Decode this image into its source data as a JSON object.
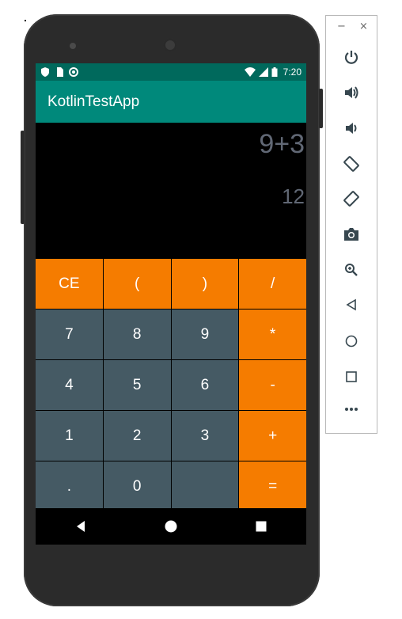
{
  "statusbar": {
    "time": "7:20",
    "icons_left": [
      "shield-icon",
      "sim-icon",
      "circle-icon"
    ],
    "icons_right": [
      "wifi-icon",
      "signal-icon",
      "battery-icon"
    ]
  },
  "app": {
    "title": "KotlinTestApp"
  },
  "display": {
    "expression": "9+3",
    "result": "12"
  },
  "keys": [
    {
      "label": "CE",
      "style": "orange"
    },
    {
      "label": "(",
      "style": "orange"
    },
    {
      "label": ")",
      "style": "orange"
    },
    {
      "label": "/",
      "style": "orange"
    },
    {
      "label": "7",
      "style": "gray"
    },
    {
      "label": "8",
      "style": "gray"
    },
    {
      "label": "9",
      "style": "gray"
    },
    {
      "label": "*",
      "style": "orange"
    },
    {
      "label": "4",
      "style": "gray"
    },
    {
      "label": "5",
      "style": "gray"
    },
    {
      "label": "6",
      "style": "gray"
    },
    {
      "label": "-",
      "style": "orange"
    },
    {
      "label": "1",
      "style": "gray"
    },
    {
      "label": "2",
      "style": "gray"
    },
    {
      "label": "3",
      "style": "gray"
    },
    {
      "label": "+",
      "style": "orange"
    },
    {
      "label": ".",
      "style": "gray"
    },
    {
      "label": "0",
      "style": "gray"
    },
    {
      "label": "",
      "style": "gray"
    },
    {
      "label": "=",
      "style": "orange"
    }
  ],
  "colors": {
    "statusbar": "#00695c",
    "appbar": "#00897b",
    "orange": "#f57c00",
    "gray": "#455a64",
    "display_text": "#616875"
  },
  "emulator_panel": {
    "header": {
      "minimize": "−",
      "close": "×"
    },
    "tools": [
      "power-icon",
      "volume-up-icon",
      "volume-down-icon",
      "rotate-left-icon",
      "rotate-right-icon",
      "camera-icon",
      "zoom-icon",
      "back-icon",
      "home-icon",
      "overview-icon",
      "more-icon"
    ]
  }
}
